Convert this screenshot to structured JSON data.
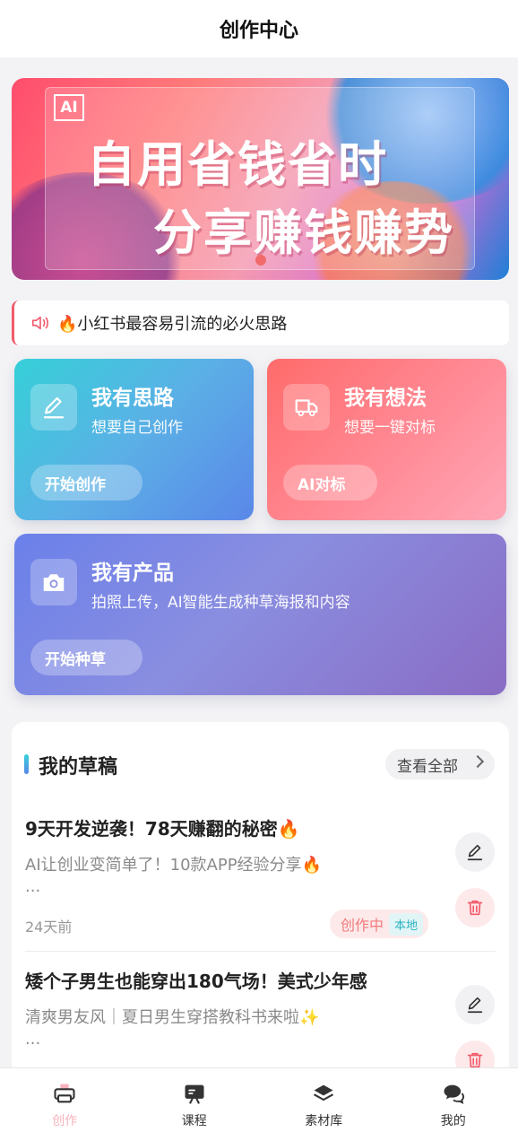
{
  "header": {
    "title": "创作中心"
  },
  "banner": {
    "badge": "AI",
    "line1": "自用省钱省时",
    "line2": "分享赚钱赚势"
  },
  "notice": {
    "text": "🔥小红书最容易引流的必火思路"
  },
  "cards": {
    "ideas": {
      "title": "我有思路",
      "subtitle": "想要自己创作",
      "button": "开始创作"
    },
    "thoughts": {
      "title": "我有想法",
      "subtitle": "想要一键对标",
      "button": "AI对标"
    },
    "product": {
      "title": "我有产品",
      "subtitle": "拍照上传，AI智能生成种草海报和内容",
      "button": "开始种草"
    }
  },
  "drafts": {
    "title": "我的草稿",
    "view_all": "查看全部",
    "items": [
      {
        "title": "9天开发逆袭！78天赚翻的秘密🔥",
        "desc": "AI让创业变简单了！10款APP经验分享🔥",
        "more": "...",
        "time": "24天前",
        "status": "创作中",
        "tag": "本地"
      },
      {
        "title": "矮个子男生也能穿出180气场！美式少年感",
        "desc": "清爽男友风｜夏日男生穿搭教科书来啦✨",
        "more": "..."
      }
    ]
  },
  "tabbar": {
    "items": [
      {
        "label": "创作",
        "icon": "create-icon",
        "active": true
      },
      {
        "label": "课程",
        "icon": "course-icon"
      },
      {
        "label": "素材库",
        "icon": "layers-icon"
      },
      {
        "label": "我的",
        "icon": "chat-bubbles-icon"
      }
    ]
  },
  "colors": {
    "accent": "#f25b6b",
    "teal": "#35d0d8",
    "blue": "#5a87e8",
    "purple": "#8a6cc4"
  }
}
